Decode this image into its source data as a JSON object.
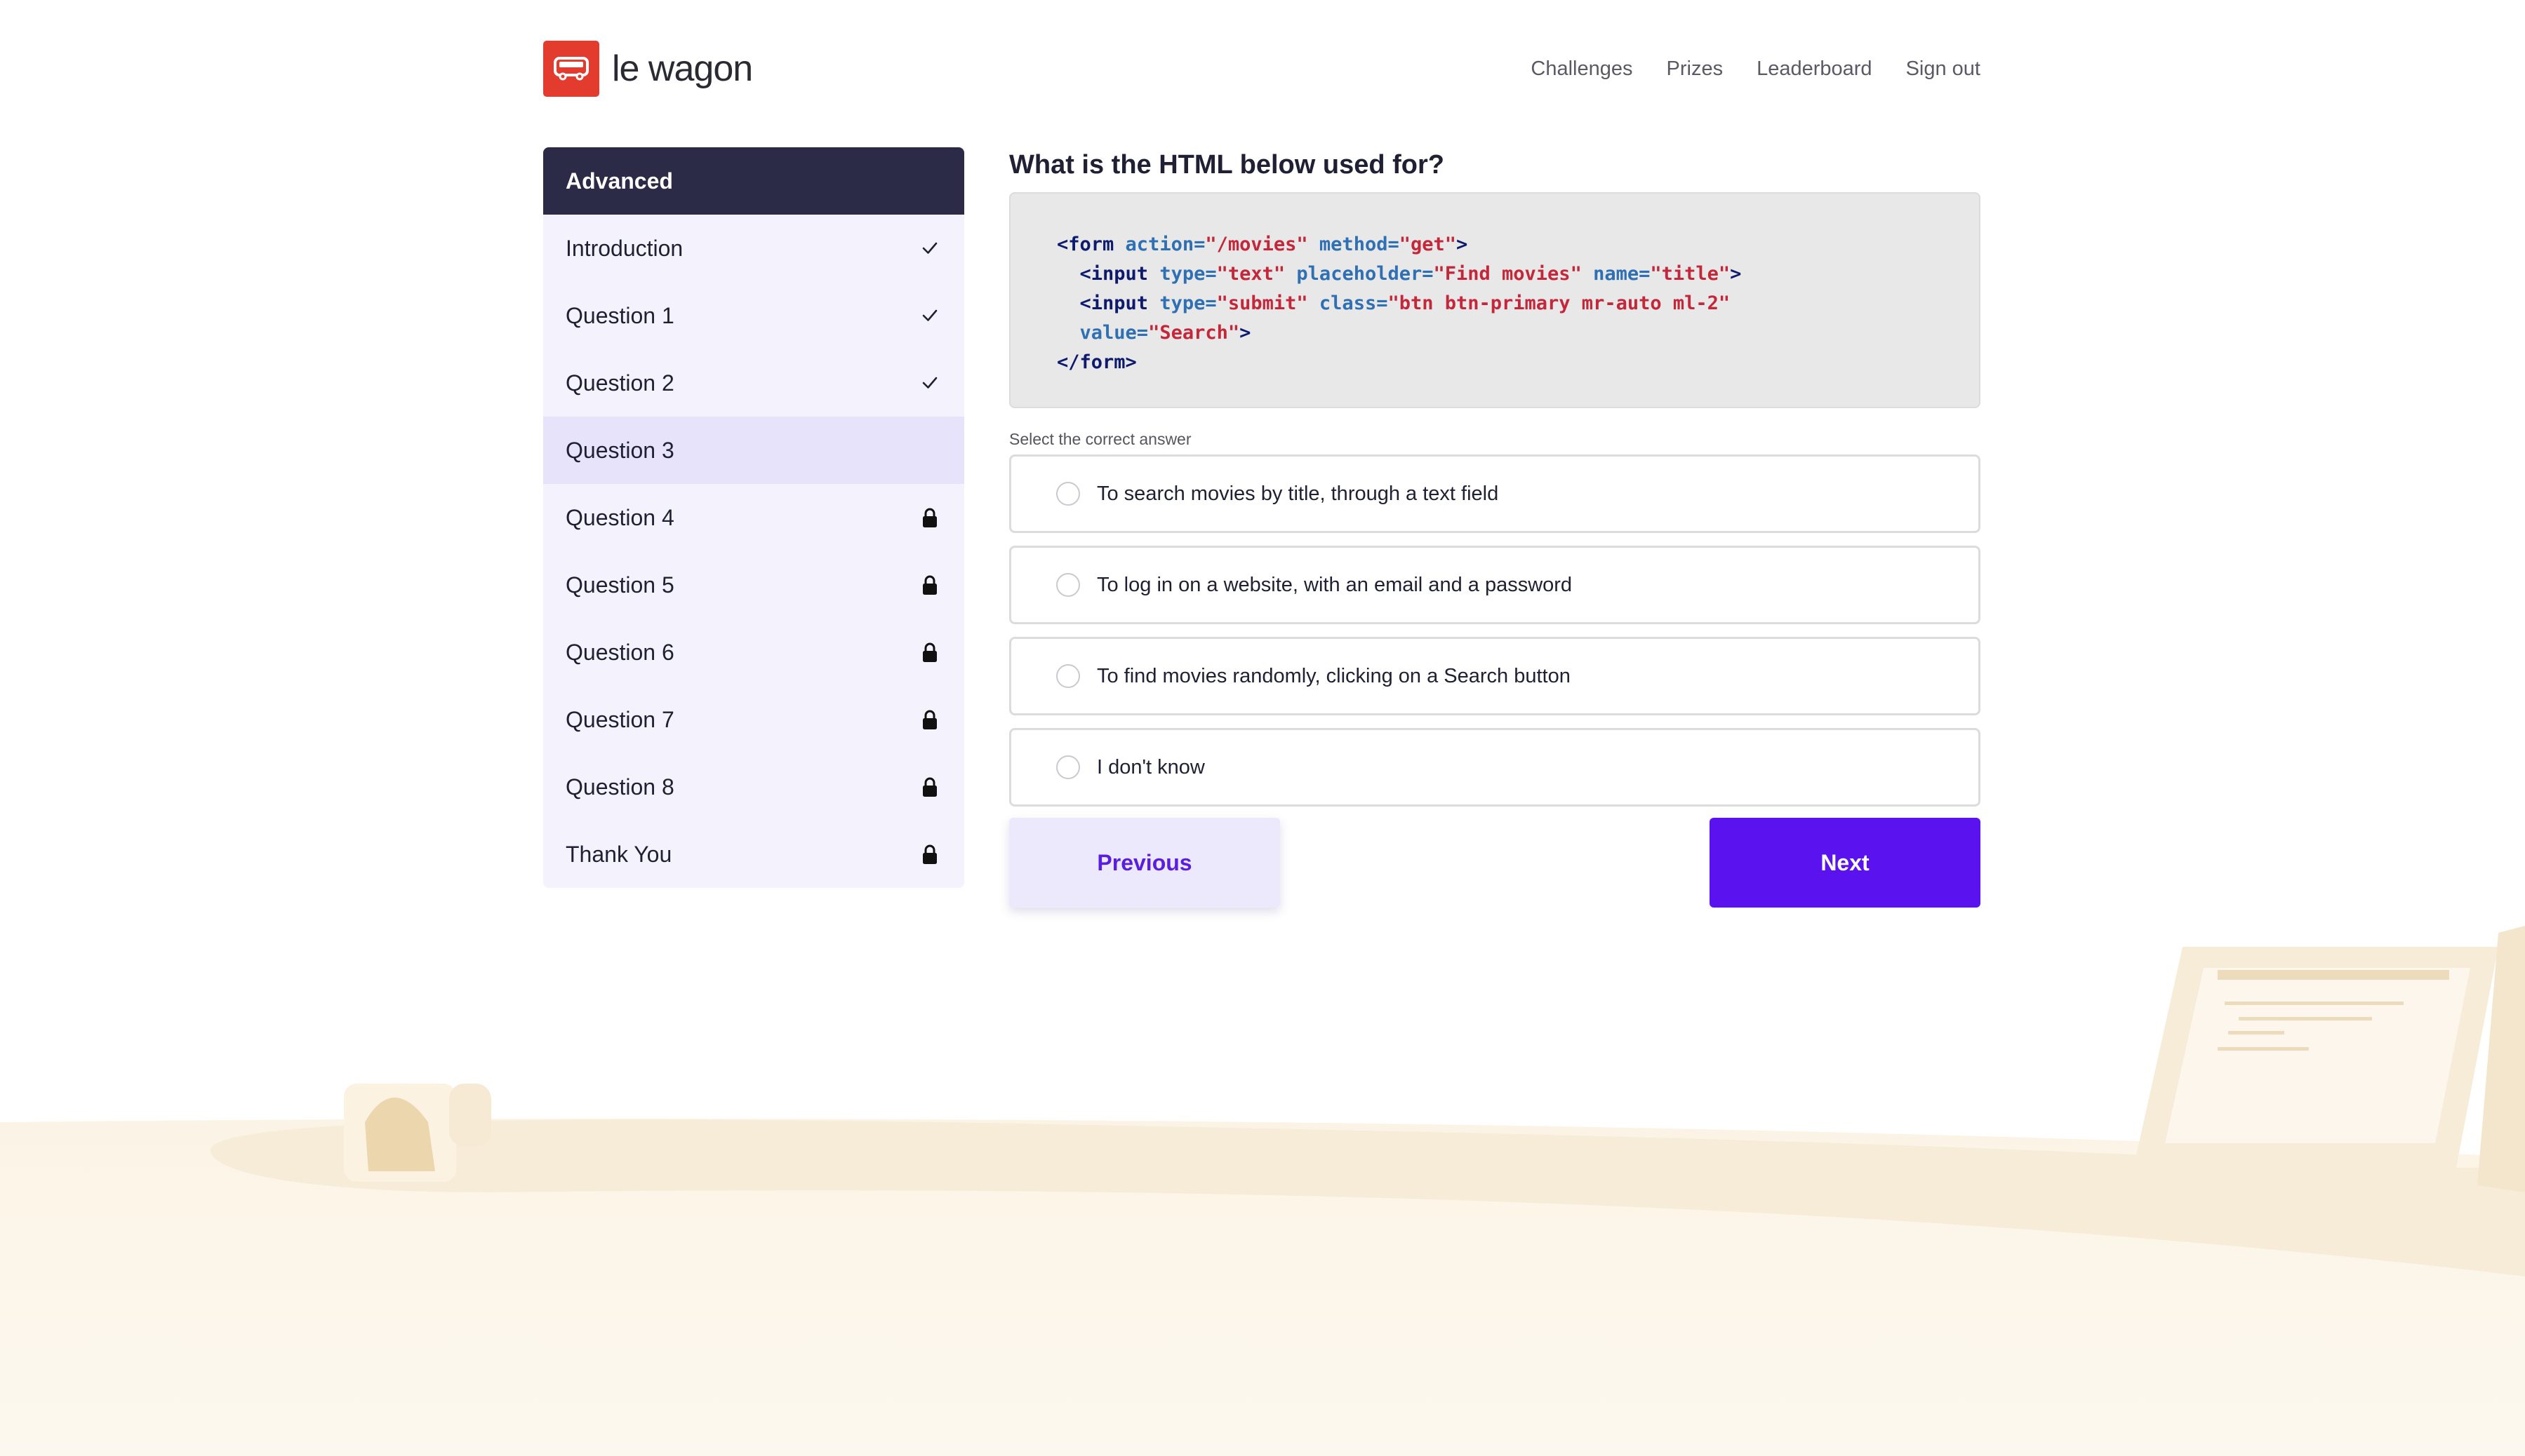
{
  "brand": {
    "name": "le wagon",
    "color": "#e33b2e"
  },
  "nav": {
    "links": [
      "Challenges",
      "Prizes",
      "Leaderboard",
      "Sign out"
    ]
  },
  "sidebar": {
    "header": "Advanced",
    "items": [
      {
        "label": "Introduction",
        "status": "completed",
        "icon": "check-icon"
      },
      {
        "label": "Question 1",
        "status": "completed",
        "icon": "check-icon"
      },
      {
        "label": "Question 2",
        "status": "completed",
        "icon": "check-icon"
      },
      {
        "label": "Question 3",
        "status": "current",
        "icon": ""
      },
      {
        "label": "Question 4",
        "status": "locked",
        "icon": "lock-icon"
      },
      {
        "label": "Question 5",
        "status": "locked",
        "icon": "lock-icon"
      },
      {
        "label": "Question 6",
        "status": "locked",
        "icon": "lock-icon"
      },
      {
        "label": "Question 7",
        "status": "locked",
        "icon": "lock-icon"
      },
      {
        "label": "Question 8",
        "status": "locked",
        "icon": "lock-icon"
      },
      {
        "label": "Thank You",
        "status": "locked",
        "icon": "lock-icon"
      }
    ]
  },
  "question": {
    "title": "What is the HTML below used for?",
    "code_lines": [
      "<form action=\"/movies\" method=\"get\">",
      "  <input type=\"text\" placeholder=\"Find movies\" name=\"title\">",
      "  <input type=\"submit\" class=\"btn btn-primary mr-auto ml-2\"",
      "  value=\"Search\">",
      "</form>"
    ],
    "select_label": "Select the correct answer",
    "options": [
      "To search movies by title, through a text field",
      "To log in on a website, with an email and a password",
      "To find movies randomly, clicking on a Search button",
      "I don't know"
    ]
  },
  "buttons": {
    "previous": "Previous",
    "next": "Next"
  },
  "colors": {
    "accent": "#5a12ee",
    "sidebar_header": "#2b2b48",
    "code_bg": "#e8e8e8"
  }
}
